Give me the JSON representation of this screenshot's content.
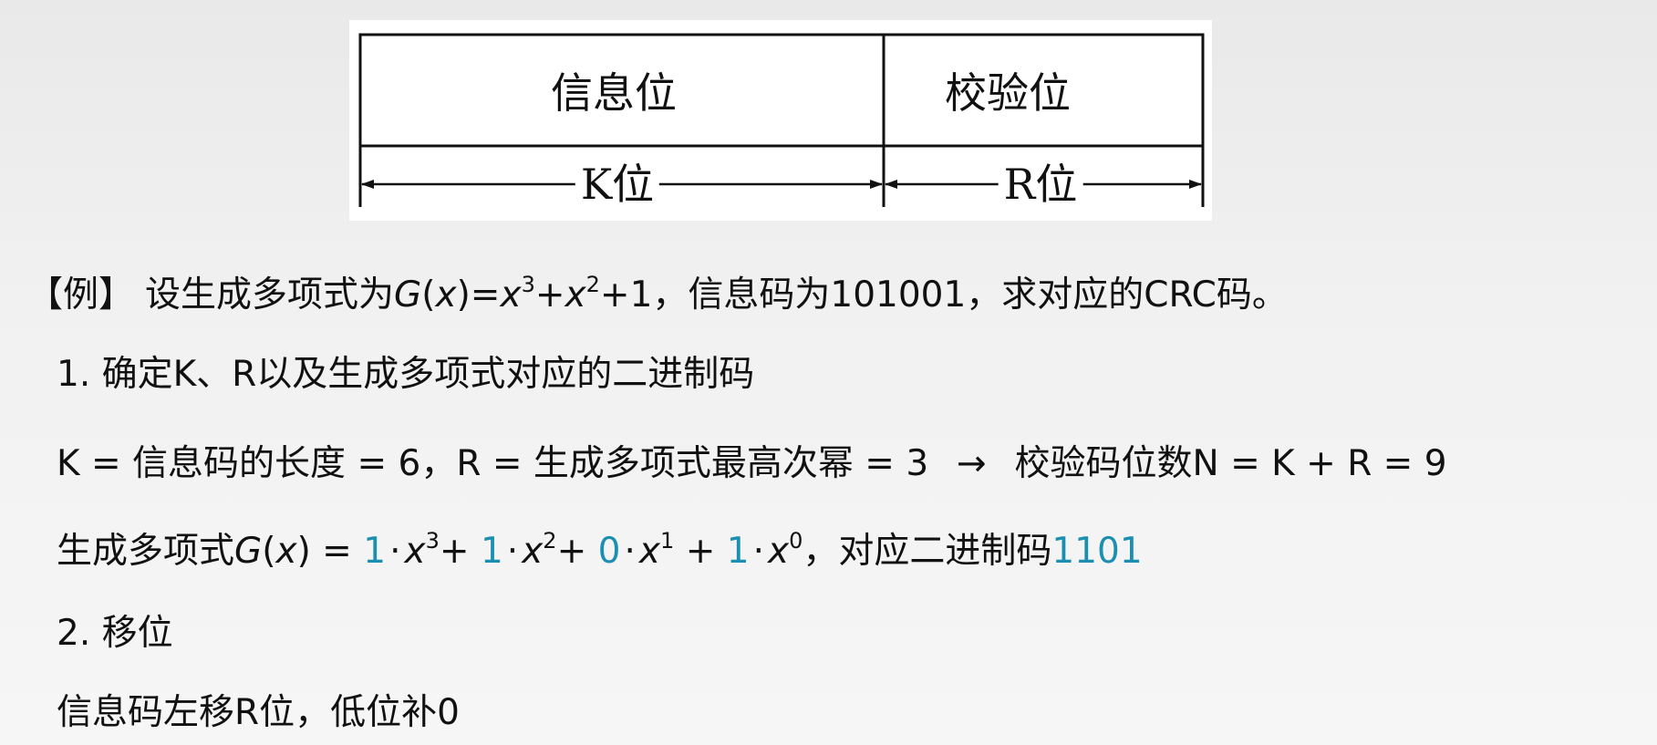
{
  "diagram": {
    "info_header": "信息位",
    "check_header": "校验位",
    "info_span": "K位",
    "check_span": "R位"
  },
  "example": {
    "tag": "【例】",
    "text_a": "设生成多项式为",
    "g": "G",
    "lp": "(",
    "x": "x",
    "rp": ")",
    "eq": "=",
    "p3": "3",
    "plus": "+",
    "p2": "2",
    "tail_one": "+1",
    "text_b": "，信息码为101001，求对应的CRC码。"
  },
  "step1": {
    "title": "1.   确定K、R以及生成多项式对应的二进制码",
    "line_a": "K = 信息码的长度 = 6，R = 生成多项式最高次幂 = 3",
    "arrow": "→",
    "line_b": "校验码位数N = K + R = 9"
  },
  "poly": {
    "label": "生成多项式",
    "g": "G",
    "lp": "(",
    "x": "x",
    "rp": ")",
    "eq": " = ",
    "c3": "1",
    "c2": "1",
    "c1": "0",
    "c0": "1",
    "dot": "·",
    "p3": "3",
    "p2": "2",
    "p1": "1",
    "p0": "0",
    "plus": "+",
    "suffix": "，对应二进制码",
    "binary": "1101"
  },
  "step2": {
    "title": "2. 移位",
    "desc": "信息码左移R位，低位补0"
  },
  "colors": {
    "highlight": "#1b8fb2"
  }
}
